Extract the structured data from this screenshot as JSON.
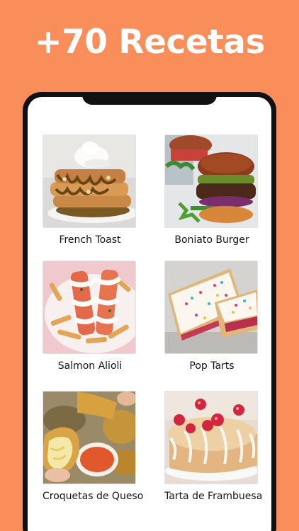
{
  "header": {
    "title": "+70 Recetas"
  },
  "recipes": [
    {
      "name": "French Toast",
      "image_icon": "french-toast-photo"
    },
    {
      "name": "Boniato Burger",
      "image_icon": "burger-photo"
    },
    {
      "name": "Salmon Alioli",
      "image_icon": "salmon-alioli-photo"
    },
    {
      "name": "Pop Tarts",
      "image_icon": "pop-tarts-photo"
    },
    {
      "name": "Croquetas de Queso",
      "image_icon": "cheese-croquettes-photo"
    },
    {
      "name": "Tarta de Frambuesa",
      "image_icon": "raspberry-tart-photo"
    }
  ],
  "colors": {
    "background": "#F98E5A",
    "phone_frame": "#111111",
    "screen": "#FFFFFF"
  }
}
